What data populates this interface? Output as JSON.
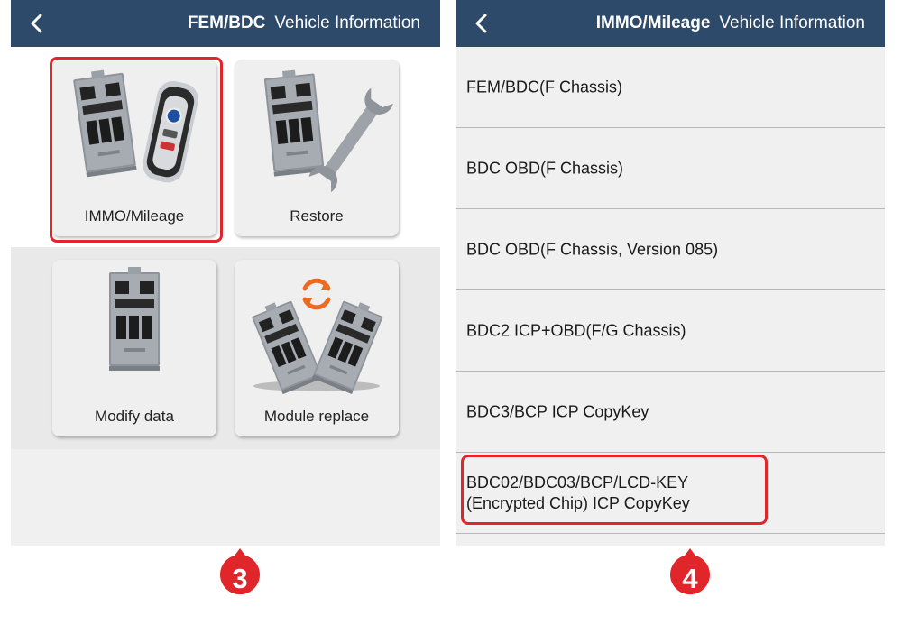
{
  "left_screen": {
    "header": {
      "module": "FEM/BDC",
      "title": "Vehicle Information"
    },
    "tiles": [
      {
        "label": "IMMO/Mileage",
        "icon": "fem-bdc-module-with-key-icon"
      },
      {
        "label": "Restore",
        "icon": "fem-bdc-module-with-wrench-icon"
      },
      {
        "label": "Modify data",
        "icon": "fem-bdc-module-icon"
      },
      {
        "label": "Module replace",
        "icon": "module-swap-icon"
      }
    ],
    "step_badge": "3"
  },
  "right_screen": {
    "header": {
      "module": "IMMO/Mileage",
      "title": "Vehicle Information"
    },
    "items": [
      {
        "label": "FEM/BDC(F Chassis)"
      },
      {
        "label": "BDC OBD(F Chassis)"
      },
      {
        "label": "BDC OBD(F Chassis, Version 085)"
      },
      {
        "label": "BDC2 ICP+OBD(F/G Chassis)"
      },
      {
        "label": "BDC3/BCP ICP CopyKey"
      },
      {
        "label": "BDC02/BDC03/BCP/LCD-KEY\n(Encrypted Chip) ICP CopyKey"
      }
    ],
    "step_badge": "4"
  },
  "colors": {
    "header_bg": "#2e4a6b",
    "highlight": "#e0262b",
    "badge": "#e0262b"
  }
}
